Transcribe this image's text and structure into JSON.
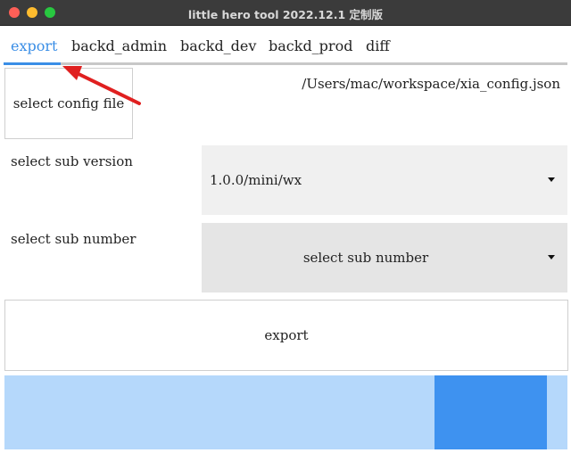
{
  "window": {
    "title": "little hero tool 2022.12.1 定制版"
  },
  "tabs": [
    {
      "label": "export",
      "active": true
    },
    {
      "label": "backd_admin"
    },
    {
      "label": "backd_dev"
    },
    {
      "label": "backd_prod"
    },
    {
      "label": "diff"
    }
  ],
  "config": {
    "button_label": "select config file",
    "path": "/Users/mac/workspace/xia_config.json"
  },
  "sub_version": {
    "label": "select sub version",
    "selected": "1.0.0/mini/wx"
  },
  "sub_number": {
    "label": "select sub number",
    "placeholder": "select sub number"
  },
  "export_button": {
    "label": "export"
  },
  "progress": {
    "fill_start": 0.764,
    "fill_end": 0.964
  },
  "colors": {
    "accent": "#3a8ee6",
    "annotation_arrow": "#e02020",
    "progress_track": "#b5d8fb",
    "progress_fill": "#3e92f0"
  }
}
